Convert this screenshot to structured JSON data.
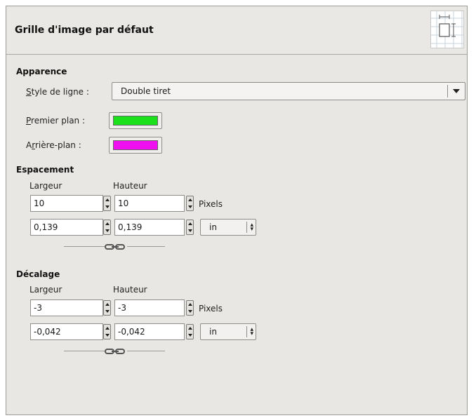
{
  "title": "Grille d'image par défaut",
  "apparence": {
    "section_label": "Apparence",
    "style_label_mnemonic": "S",
    "style_label_rest": "tyle de ligne :",
    "style_value": "Double tiret",
    "premier_mnemonic": "P",
    "premier_rest": "remier plan :",
    "premier_color": "#1de01d",
    "arriere_prefix": "A",
    "arriere_mnemonic": "r",
    "arriere_rest": "rière-plan :",
    "arriere_color": "#ef10ef"
  },
  "espacement": {
    "section_label": "Espacement",
    "largeur_label": "Largeur",
    "hauteur_label": "Hauteur",
    "largeur_px": "10",
    "hauteur_px": "10",
    "px_unit": "Pixels",
    "largeur_in": "0,139",
    "hauteur_in": "0,139",
    "unit": "in"
  },
  "decalage": {
    "section_label": "Décalage",
    "largeur_label": "Largeur",
    "hauteur_label": "Hauteur",
    "largeur_px": "-3",
    "hauteur_px": "-3",
    "px_unit": "Pixels",
    "largeur_in": "-0,042",
    "hauteur_in": "-0,042",
    "unit": "in"
  },
  "icons": [
    "grid-icon",
    "chain-icon",
    "dropdown-arrow-icon",
    "spinner-arrows-icon"
  ]
}
